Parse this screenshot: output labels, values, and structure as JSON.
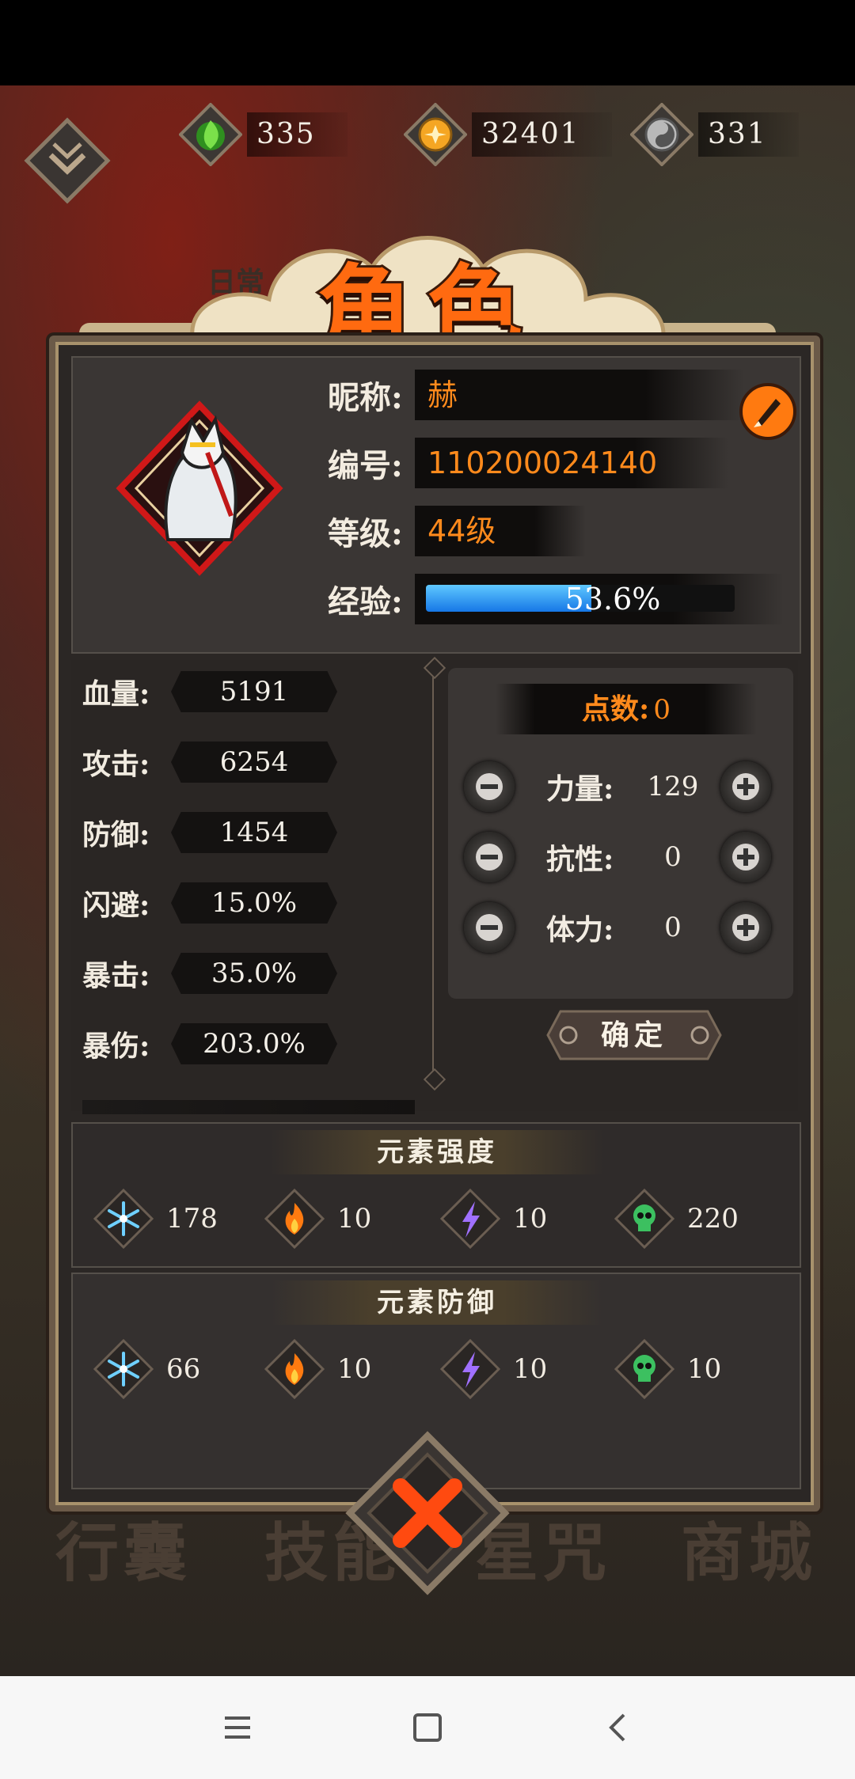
{
  "resources": [
    {
      "name": "jade",
      "icon": "green-flame-icon",
      "value": "335",
      "color": "#5fd030"
    },
    {
      "name": "gold",
      "icon": "gold-coin-icon",
      "value": "32401",
      "color": "#f5a623"
    },
    {
      "name": "silver",
      "icon": "silver-coin-icon",
      "value": "331",
      "color": "#b9b9b9"
    }
  ],
  "background": {
    "daily_tab": "日常",
    "bottom_tabs": [
      "行囊",
      "技能",
      "星咒",
      "商城"
    ]
  },
  "title": "角色",
  "profile": {
    "nickname_label": "昵称:",
    "nickname": "赫",
    "id_label": "编号:",
    "id": "110200024140",
    "level_label": "等级:",
    "level": "44级",
    "exp_label": "经验:",
    "exp_text": "53.6%",
    "exp_fraction": 0.536
  },
  "stats": [
    {
      "label": "血量:",
      "value": "5191"
    },
    {
      "label": "攻击:",
      "value": "6254"
    },
    {
      "label": "防御:",
      "value": "1454"
    },
    {
      "label": "闪避:",
      "value": "15.0%"
    },
    {
      "label": "暴击:",
      "value": "35.0%"
    },
    {
      "label": "暴伤:",
      "value": "203.0%"
    }
  ],
  "points": {
    "label": "点数:",
    "value": "0",
    "attributes": [
      {
        "label": "力量:",
        "value": "129"
      },
      {
        "label": "抗性:",
        "value": "0"
      },
      {
        "label": "体力:",
        "value": "0"
      }
    ],
    "confirm": "确定"
  },
  "element_strength": {
    "title": "元素强度",
    "items": [
      {
        "icon": "ice-icon",
        "value": "178"
      },
      {
        "icon": "fire-icon",
        "value": "10"
      },
      {
        "icon": "lightning-icon",
        "value": "10"
      },
      {
        "icon": "poison-skull-icon",
        "value": "220"
      }
    ]
  },
  "element_defense": {
    "title": "元素防御",
    "items": [
      {
        "icon": "ice-icon",
        "value": "66"
      },
      {
        "icon": "fire-icon",
        "value": "10"
      },
      {
        "icon": "lightning-icon",
        "value": "10"
      },
      {
        "icon": "poison-skull-icon",
        "value": "10"
      }
    ]
  },
  "colors": {
    "accent": "#ff8a1c",
    "exp_bar": "#1e8ef0",
    "title": "#ff6a10"
  }
}
